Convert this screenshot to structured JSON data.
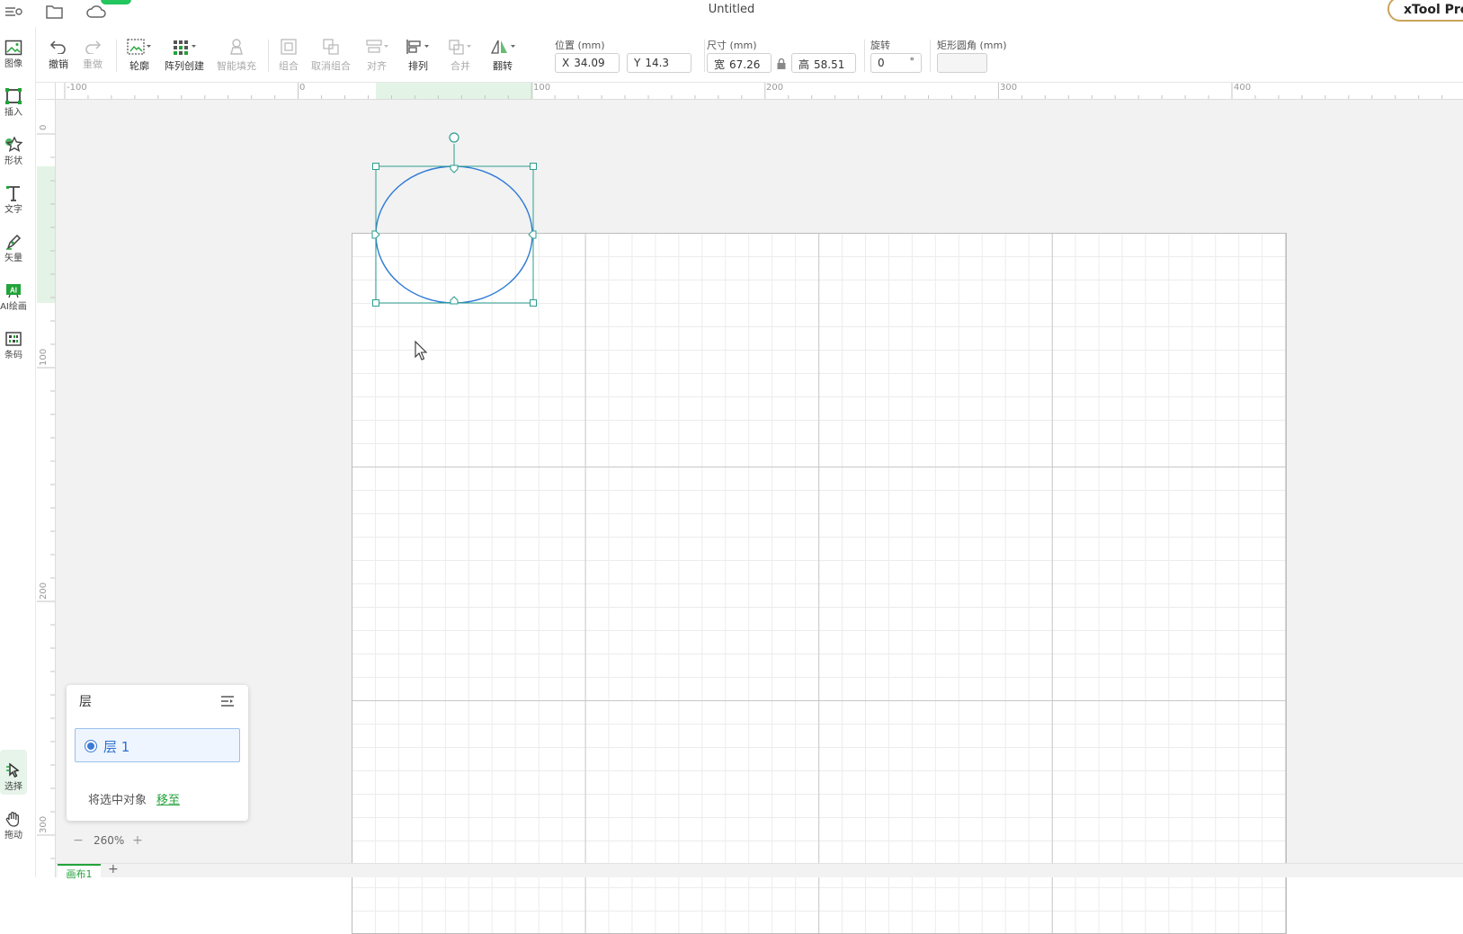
{
  "window": {
    "title": "Untitled",
    "product": "xTool Pro"
  },
  "left_tools": [
    {
      "id": "image",
      "label": "图像",
      "icon": "image-icon"
    },
    {
      "id": "insert",
      "label": "插入",
      "icon": "insert-frame-icon"
    },
    {
      "id": "shape",
      "label": "形状",
      "icon": "star-shape-icon"
    },
    {
      "id": "text",
      "label": "文字",
      "icon": "text-icon"
    },
    {
      "id": "vector",
      "label": "矢量",
      "icon": "pen-icon"
    },
    {
      "id": "ai",
      "label": "AI绘画",
      "icon": "ai-icon"
    },
    {
      "id": "barcode",
      "label": "条码",
      "icon": "qrcode-icon"
    },
    {
      "id": "select",
      "label": "选择",
      "icon": "cursor-icon"
    },
    {
      "id": "pan",
      "label": "拖动",
      "icon": "hand-icon"
    }
  ],
  "toolbar": {
    "undo": "撤销",
    "redo": "重做",
    "outline": "轮廓",
    "array": "阵列创建",
    "smart_fill": "智能填充",
    "group": "组合",
    "ungroup": "取消组合",
    "align": "对齐",
    "arrange": "排列",
    "merge": "合并",
    "flip": "翻转"
  },
  "properties": {
    "position_label": "位置 (mm)",
    "x_prefix": "X",
    "x_value": "34.09",
    "y_prefix": "Y",
    "y_value": "14.3",
    "size_label": "尺寸 (mm)",
    "w_prefix": "宽",
    "w_value": "67.26",
    "h_prefix": "高",
    "h_value": "58.51",
    "rotation_label": "旋转",
    "rotation_value": "0",
    "rotation_unit": "°",
    "corner_label": "矩形圆角 (mm)",
    "corner_value": ""
  },
  "rulers": {
    "top_labels": [
      "-100",
      "0",
      "100",
      "200",
      "300",
      "400"
    ],
    "left_labels": [
      "0",
      "100",
      "200",
      "300"
    ]
  },
  "layers": {
    "title": "层",
    "items": [
      {
        "name": "层 1"
      }
    ],
    "move_text": "将选中对象",
    "move_link": "移至"
  },
  "zoom": {
    "minus": "−",
    "value": "260%",
    "plus": "+"
  },
  "canvas_tabs": {
    "items": [
      "画布1"
    ],
    "add": "+"
  },
  "colors": {
    "accent": "#22a33a",
    "selection": "#2a9d8f",
    "ellipse": "#2f7bd6"
  }
}
